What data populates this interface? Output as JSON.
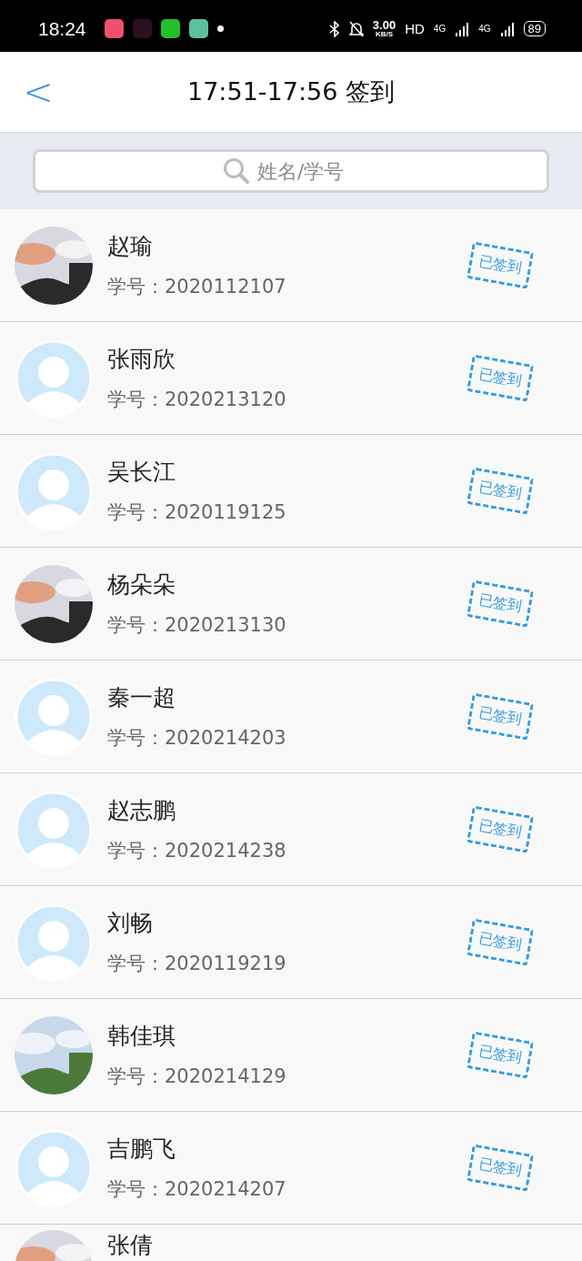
{
  "status_bar": {
    "time": "18:24",
    "speed_value": "3.00",
    "speed_unit": "KB/S",
    "hd": "HD",
    "network_1": "4G",
    "network_2": "4G",
    "battery": "89"
  },
  "header": {
    "back": "<",
    "title": "17:51-17:56 签到"
  },
  "search": {
    "placeholder": "姓名/学号"
  },
  "students": [
    {
      "name": "赵瑜",
      "id_label": "学号：",
      "id": "2020112107",
      "kind": "picture",
      "signed": true,
      "stamp": "已签到"
    },
    {
      "name": "张雨欣",
      "id_label": "学号：",
      "id": "2020213120",
      "kind": "default",
      "signed": true,
      "stamp": "已签到"
    },
    {
      "name": "吴长江",
      "id_label": "学号：",
      "id": "2020119125",
      "kind": "default",
      "signed": true,
      "stamp": "已签到"
    },
    {
      "name": "杨朵朵",
      "id_label": "学号：",
      "id": "2020213130",
      "kind": "picture",
      "signed": true,
      "stamp": "已签到"
    },
    {
      "name": "秦一超",
      "id_label": "学号：",
      "id": "2020214203",
      "kind": "default",
      "signed": true,
      "stamp": "已签到"
    },
    {
      "name": "赵志鹏",
      "id_label": "学号：",
      "id": "2020214238",
      "kind": "default",
      "signed": true,
      "stamp": "已签到"
    },
    {
      "name": "刘畅",
      "id_label": "学号：",
      "id": "2020119219",
      "kind": "default",
      "signed": true,
      "stamp": "已签到"
    },
    {
      "name": "韩佳琪",
      "id_label": "学号：",
      "id": "2020214129",
      "kind": "picture",
      "signed": true,
      "stamp": "已签到"
    },
    {
      "name": "吉鹏飞",
      "id_label": "学号：",
      "id": "2020214207",
      "kind": "default",
      "signed": true,
      "stamp": "已签到"
    },
    {
      "name": "张倩",
      "kind": "picture"
    }
  ]
}
